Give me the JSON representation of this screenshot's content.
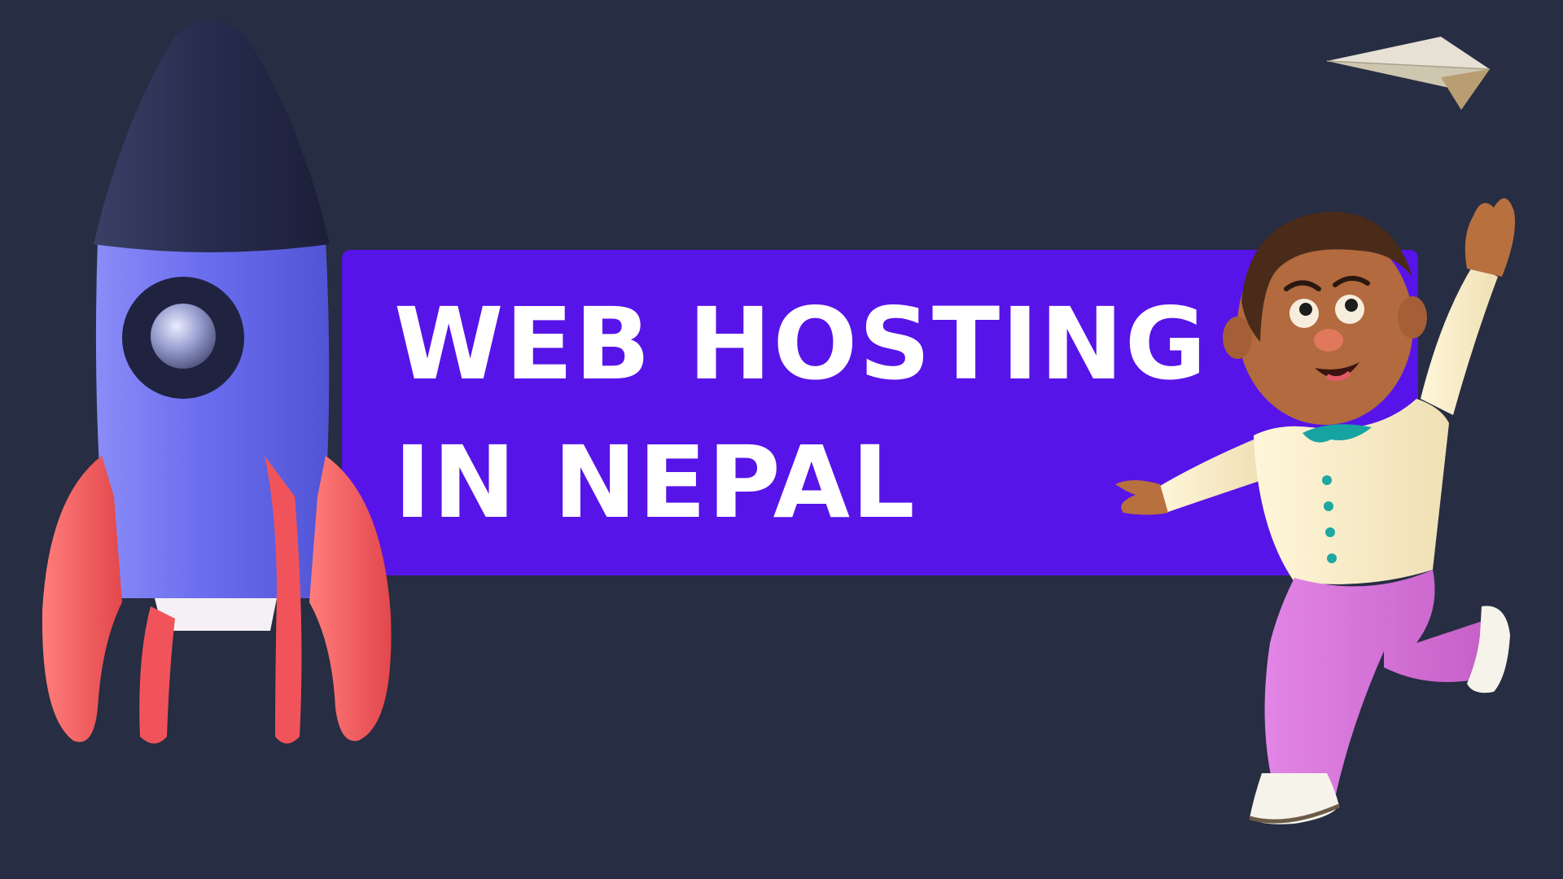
{
  "headline": {
    "line1": "WEB HOSTING",
    "line2": "IN NEPAL"
  },
  "colors": {
    "background": "#272d42",
    "banner": "#5714e8",
    "headline_text": "#ffffff",
    "rocket_body": "#6d6ff0",
    "rocket_nose": "#25294a",
    "rocket_fins": "#f25a5c",
    "kid_skin": "#b26a3e",
    "kid_shirt": "#f8ecc6",
    "kid_pants": "#d66bd6",
    "kid_collar": "#17a3a1"
  },
  "icons": {
    "rocket": "rocket-icon",
    "paper_plane": "paper-plane-icon",
    "character": "waving-kid-illustration"
  }
}
